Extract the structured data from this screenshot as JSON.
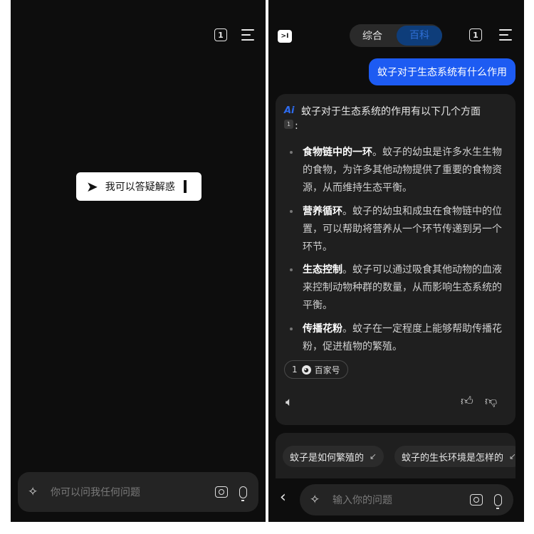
{
  "left": {
    "tab_count": "1",
    "hint_text": "我可以答疑解惑",
    "input_placeholder": "你可以问我任何问题"
  },
  "right": {
    "logo": ">I",
    "modes": [
      "综合",
      "百科"
    ],
    "tab_count": "1",
    "user_question": "蚊子对于生态系统有什么作用",
    "ai_badge": "Ai",
    "answer_intro": "蚊子对于生态系统的作用有以下几个方面",
    "citation": "1",
    "colon": ":",
    "bullets": [
      {
        "title": "食物链中的一环",
        "text": "。蚊子的幼虫是许多水生生物的食物，为许多其他动物提供了重要的食物资源，从而维持生态平衡。"
      },
      {
        "title": "营养循环",
        "text": "。蚊子的幼虫和成虫在食物链中的位置，可以帮助将营养从一个环节传递到另一个环节。"
      },
      {
        "title": "生态控制",
        "text": "。蚊子可以通过吸食其他动物的血液来控制动物种群的数量，从而影响生态系统的平衡。"
      },
      {
        "title": "传播花粉",
        "text": "。蚊子在一定程度上能够帮助传播花粉，促进植物的繁殖。"
      }
    ],
    "source": {
      "count": "1",
      "name": "百家号"
    },
    "suggestions": [
      "蚊子是如何繁殖的",
      "蚊子的生长环境是怎样的"
    ],
    "input_placeholder": "输入你的问题"
  }
}
